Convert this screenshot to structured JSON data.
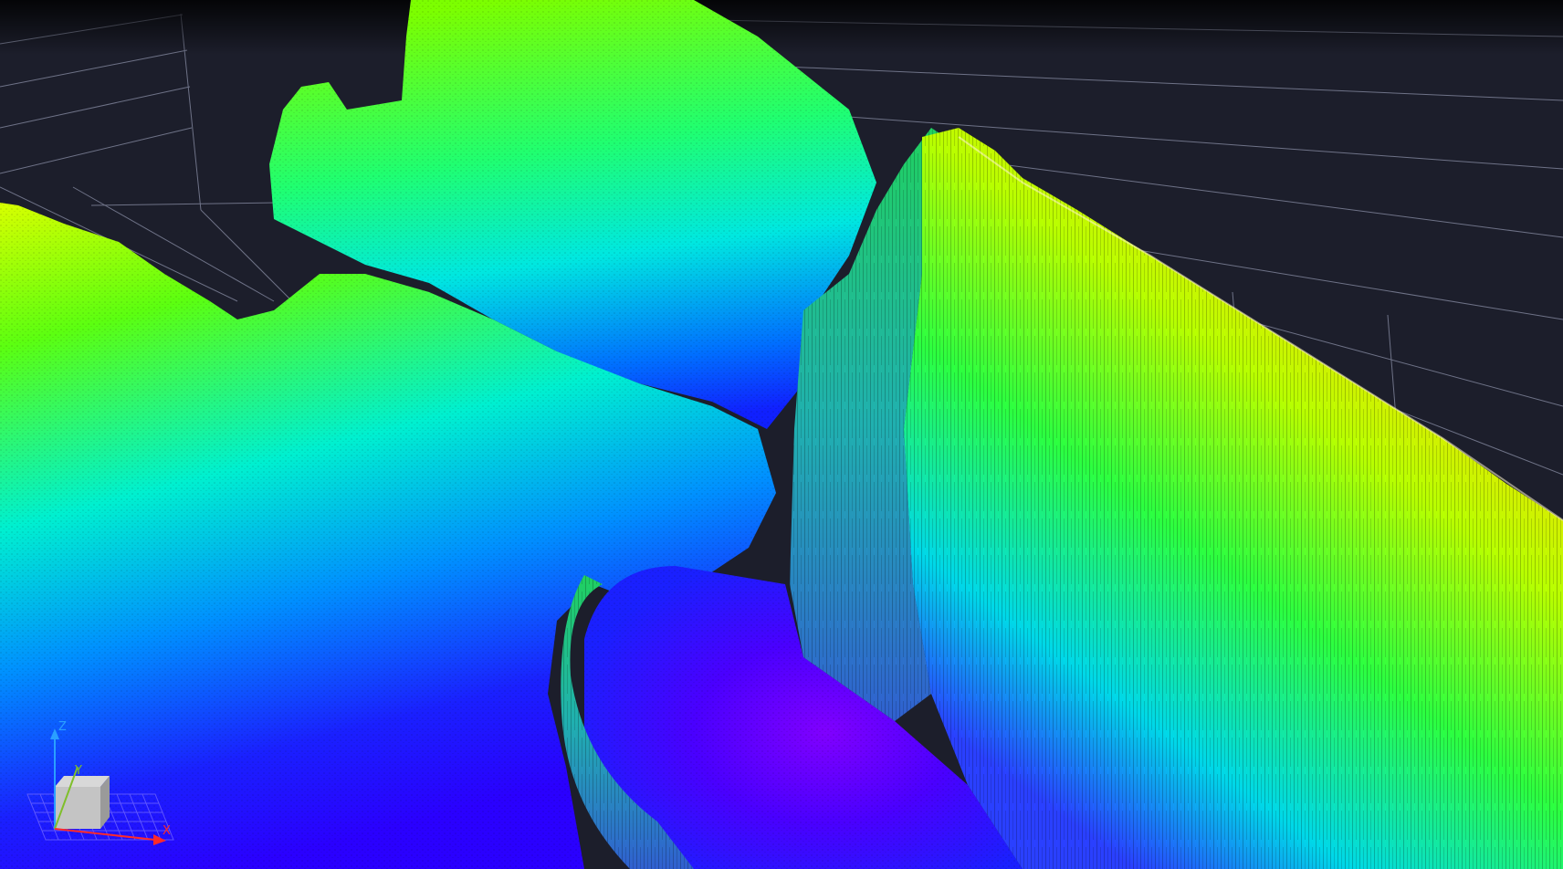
{
  "viewer": {
    "colors": {
      "background": "#1c1e2b",
      "grid": "#8a8fa6",
      "ramp": [
        "#7a00ff",
        "#1a00ff",
        "#0058ff",
        "#00e0ff",
        "#00ff7a",
        "#7cff00",
        "#ffff00",
        "#ff8c00"
      ]
    },
    "axis_gizmo": {
      "z_label": "Z",
      "y_label": "Y",
      "x_label": "X",
      "x_color": "#ff2a2a",
      "y_color": "#7fbf2a",
      "z_color": "#2a9fff"
    }
  }
}
